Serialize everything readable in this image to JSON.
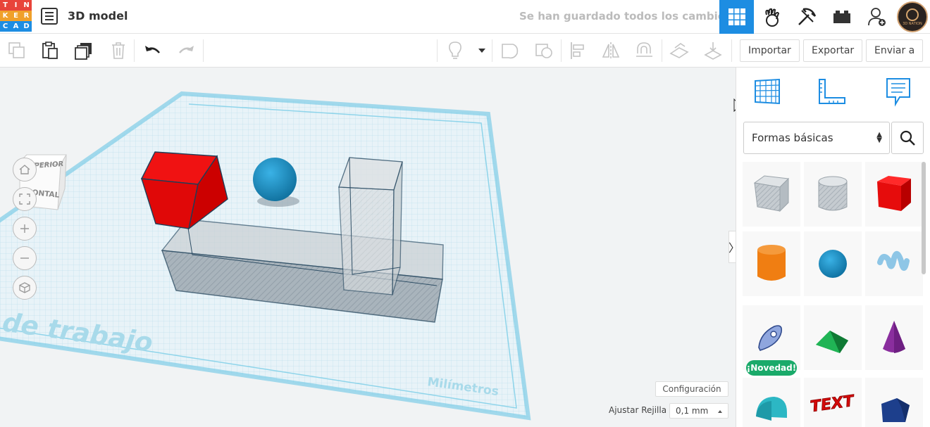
{
  "header": {
    "logo_letters": [
      "T",
      "I",
      "N",
      "K",
      "E",
      "R",
      "C",
      "A",
      "D"
    ],
    "logo_colors": [
      "#e8443a",
      "#e8443a",
      "#e8443a",
      "#f0a02a",
      "#f0a02a",
      "#f0a02a",
      "#1d8de2",
      "#1d8de2",
      "#1d8de2"
    ],
    "title": "3D model",
    "save_status": "Se han guardado todos los cambios.",
    "view_buttons": [
      "grid-view-icon",
      "workbench-icon",
      "pickaxe-icon",
      "bricks-icon",
      "add-user-icon"
    ],
    "avatar_text": "3D NATION",
    "accent": "#1d8de2"
  },
  "toolbar": {
    "import_label": "Importar",
    "export_label": "Exportar",
    "send_label": "Enviar a"
  },
  "workplane": {
    "viewcube_top": "SUPERIOR",
    "viewcube_front": "FRONTAL",
    "plane_text": "de trabajo",
    "units_text": "Milímetros",
    "config_label": "Configuración",
    "snap_label": "Ajustar Rejilla",
    "snap_value": "0,1 mm"
  },
  "panel": {
    "category": "Formas básicas",
    "new_badge": "¡Novedad!",
    "text_shape": "TEXT"
  }
}
